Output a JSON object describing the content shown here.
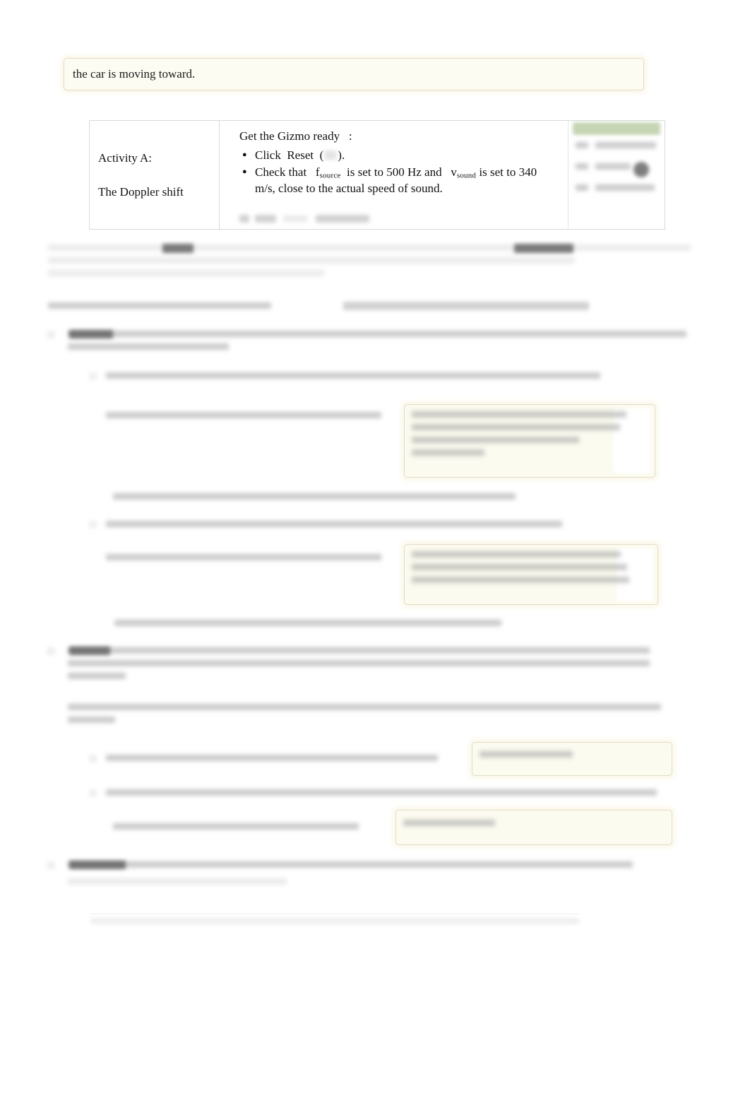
{
  "document": {
    "type": "worksheet",
    "legible_note": "Only the top answer box and the Activity A table header are legible; the remainder of the page is blurred/redacted."
  },
  "top_answer": {
    "text": "the car is moving toward."
  },
  "activity_table": {
    "title": "Activity A:",
    "subtitle": "The Doppler shift",
    "get_ready_heading": "Get the Gizmo ready",
    "get_ready_colon": ":",
    "bullets": [
      {
        "prefix": "Click",
        "action": "Reset",
        "open_paren": "(",
        "icon": "reset-button-icon",
        "close_paren": ").",
        "full": "Click Reset ( )."
      },
      {
        "lead": "Check that",
        "symbol1_base": "f",
        "symbol1_sub": "source",
        "middle": "is set to 500 Hz and",
        "symbol2_base": "v",
        "symbol2_sub": "sound",
        "tail": "is set to 340 m/s, close to the actual speed of sound.",
        "full": "Check that fsource is set to 500 Hz and vsound is set to 340 m/s, close to the actual speed of sound."
      }
    ],
    "side_panel": {
      "label": "blurred-gizmo-control-panel",
      "accent_color": "#c6d6b5"
    }
  },
  "colors": {
    "page_background": "#ffffff",
    "answer_box_fill": "#fcfbf0",
    "answer_box_border": "#e3ddc6",
    "table_border": "#d9d9d9",
    "green_accent": "#c6d6b5",
    "text": "#111111"
  }
}
